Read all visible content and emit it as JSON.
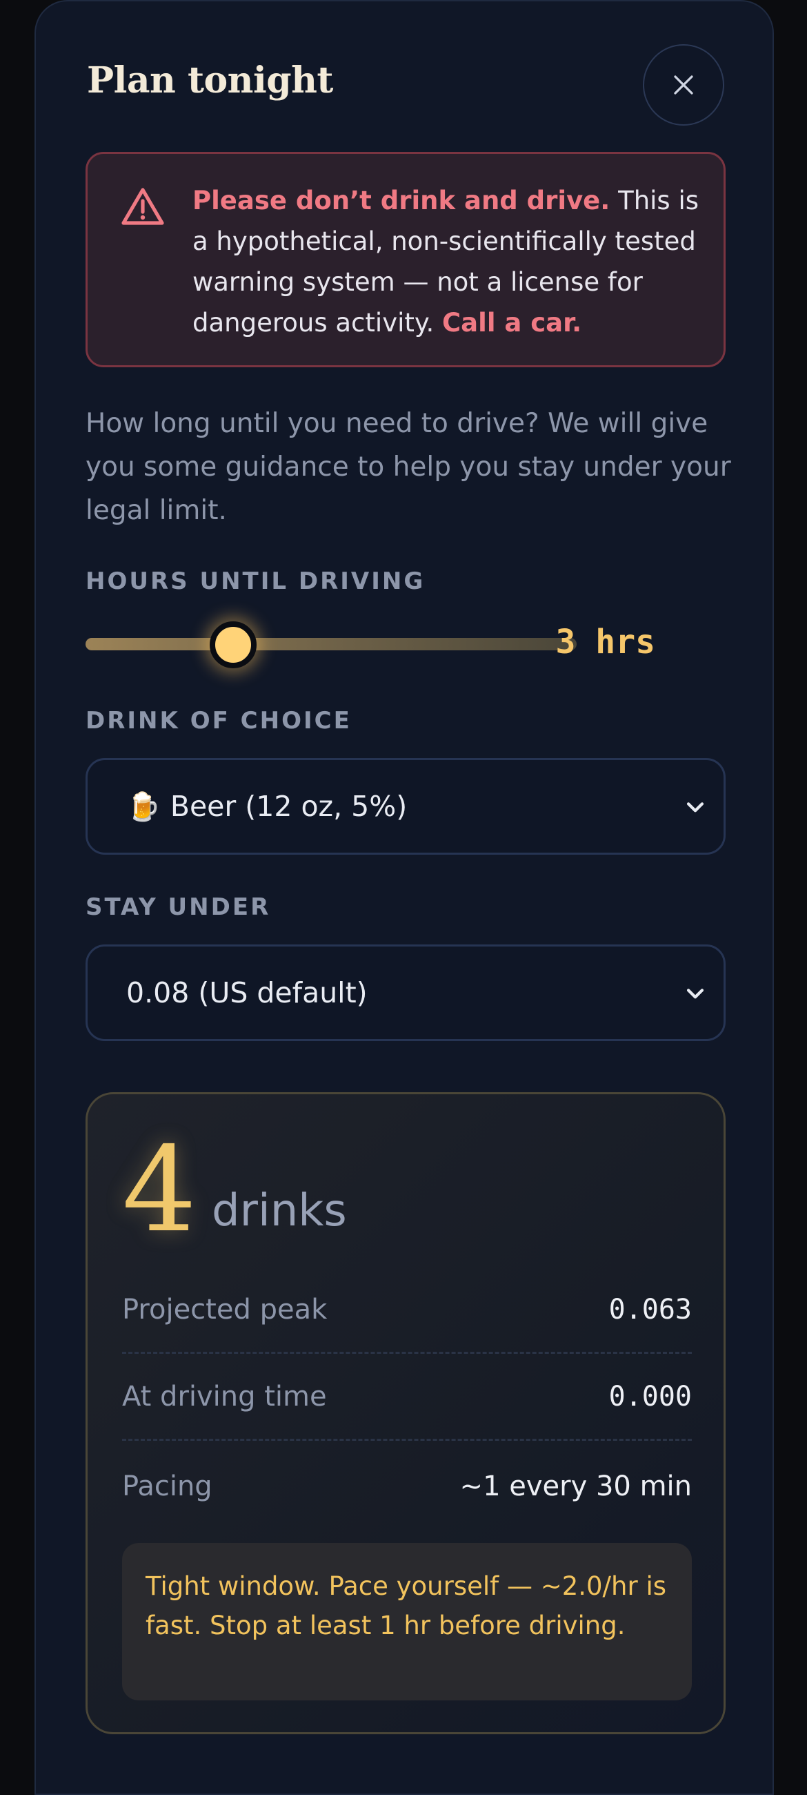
{
  "sheet": {
    "title": "Plan tonight",
    "close_icon": "close-icon"
  },
  "warning": {
    "icon": "warning-triangle-icon",
    "strong_lead": "Please don’t drink and drive.",
    "body": " This is a hypothetical, non-scientifically tested warning system — not a license for dangerous activity. ",
    "call_to_action": "Call a car."
  },
  "intro": "How long until you need to drive? We will give you some guidance to help you stay under your legal limit.",
  "hours": {
    "label": "HOURS UNTIL DRIVING",
    "value_text": "3 hrs",
    "slider_fraction": 0.3
  },
  "drink": {
    "label": "DRINK OF CHOICE",
    "icon": "🍺",
    "selected": "Beer (12 oz, 5%)"
  },
  "limit": {
    "label": "STAY UNDER",
    "selected": "0.08 (US default)"
  },
  "result": {
    "count": "4",
    "unit": "drinks",
    "rows": [
      {
        "key": "Projected peak",
        "value": "0.063"
      },
      {
        "key": "At driving time",
        "value": "0.000"
      },
      {
        "key": "Pacing",
        "value": "~1 every 30 min"
      }
    ],
    "tip": "Tight window. Pace yourself — ~2.0/hr is fast. Stop at least 1 hr before driving."
  },
  "colors": {
    "accent": "#f6c66a",
    "warning": "#f07a84",
    "background": "#101727"
  }
}
